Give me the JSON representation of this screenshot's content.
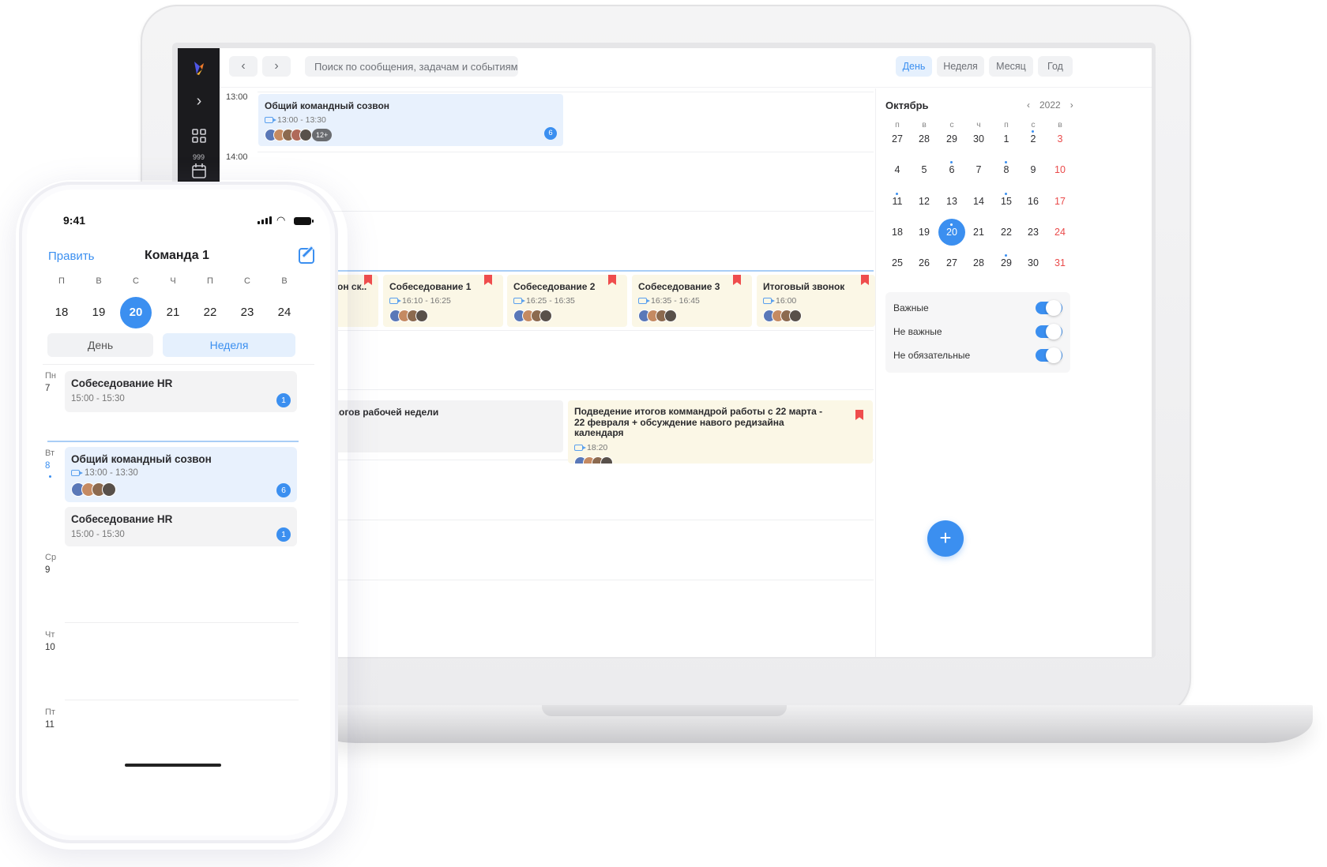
{
  "toolbar": {
    "search_placeholder": "Поиск по сообщения, задачам и событиям",
    "views": [
      "День",
      "Неделя",
      "Месяц",
      "Год"
    ],
    "active_view": "День"
  },
  "sidebar": {
    "badge_count": "999"
  },
  "timeline": {
    "hours": [
      "13:00",
      "14:00"
    ],
    "events": [
      {
        "title": "Общий командный созвон",
        "time": "13:00 - 13:30",
        "more": "12+",
        "badge": "6"
      },
      {
        "title": "...он ск.."
      },
      {
        "title": "Собеседование 1",
        "time": "16:10 - 16:25"
      },
      {
        "title": "Собеседование 2",
        "time": "16:25 - 16:35"
      },
      {
        "title": "Собеседование 3",
        "time": "16:35 - 16:45"
      },
      {
        "title": "Итоговый звонок",
        "time": "16:00"
      },
      {
        "title": "...огов рабочей недели"
      },
      {
        "title": "Подведение итогов коммандрой работы с 22 марта - 22 февраля + обсуждение навого редизайна календаря",
        "time": "18:20"
      }
    ]
  },
  "calendar": {
    "month": "Октябрь",
    "year": "2022",
    "weekdays": [
      "п",
      "в",
      "с",
      "ч",
      "п",
      "с",
      "в"
    ],
    "weeks": [
      [
        "27",
        "28",
        "29",
        "30",
        "1",
        "2",
        "3"
      ],
      [
        "4",
        "5",
        "6",
        "7",
        "8",
        "9",
        "10"
      ],
      [
        "11",
        "12",
        "13",
        "14",
        "15",
        "16",
        "17"
      ],
      [
        "18",
        "19",
        "20",
        "21",
        "22",
        "23",
        "24"
      ],
      [
        "25",
        "26",
        "27",
        "28",
        "29",
        "30",
        "31"
      ]
    ],
    "selected": "20"
  },
  "filters": [
    {
      "label": "Важные",
      "on": true
    },
    {
      "label": "Не важные",
      "on": true
    },
    {
      "label": "Не обязательные",
      "on": true
    }
  ],
  "phone": {
    "status_time": "9:41",
    "edit_label": "Править",
    "title": "Команда 1",
    "weekdays": [
      "П",
      "В",
      "С",
      "Ч",
      "П",
      "С",
      "В"
    ],
    "days": [
      "18",
      "19",
      "20",
      "21",
      "22",
      "23",
      "24"
    ],
    "selected_day": "20",
    "segments": [
      "День",
      "Неделя"
    ],
    "active_segment": "Неделя",
    "agenda": [
      {
        "dow": "Пн",
        "day": "7"
      },
      {
        "dow": "Вт",
        "day": "8"
      },
      {
        "dow": "Ср",
        "day": "9"
      },
      {
        "dow": "Чт",
        "day": "10"
      },
      {
        "dow": "Пт",
        "day": "11"
      }
    ],
    "cards": [
      {
        "title": "Собеседование HR",
        "time": "15:00 - 15:30",
        "badge": "1"
      },
      {
        "title": "Общий командный созвон",
        "time": "13:00 - 13:30",
        "badge": "6"
      },
      {
        "title": "Собеседование HR",
        "time": "15:00 - 15:30",
        "badge": "1"
      }
    ]
  },
  "colors": {
    "accent": "#3b8ff0",
    "weekend": "#ea4b4b",
    "event_yellow": "#fbf7e6",
    "event_blue": "#e8f1fd",
    "bookmark": "#ef4d4d"
  }
}
